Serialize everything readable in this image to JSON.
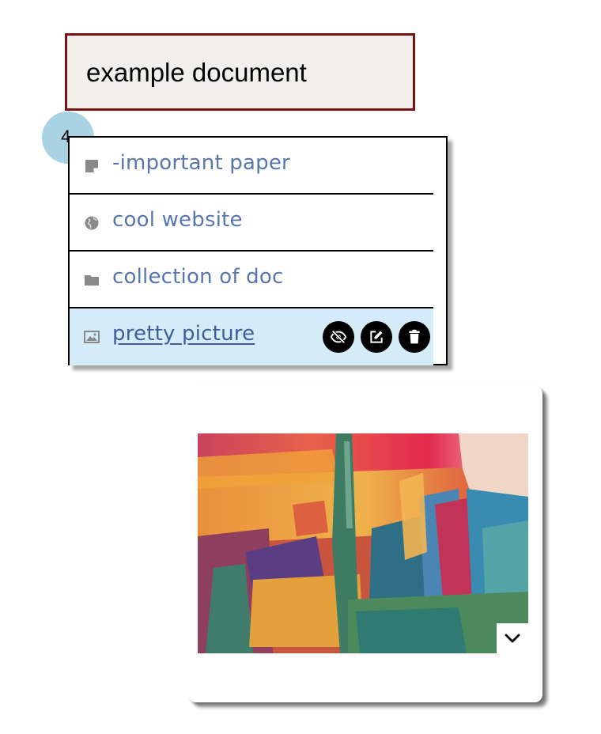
{
  "document": {
    "title": "example document",
    "item_count": "4"
  },
  "items": [
    {
      "label": "-important paper",
      "icon": "note-icon",
      "kind": "document"
    },
    {
      "label": "cool website",
      "icon": "globe-icon",
      "kind": "website"
    },
    {
      "label": "collection of doc",
      "icon": "folder-icon",
      "kind": "folder"
    },
    {
      "label": "pretty picture",
      "icon": "image-icon",
      "kind": "image",
      "selected": true
    }
  ],
  "selected_item_actions": [
    "hide-icon",
    "edit-icon",
    "delete-icon"
  ],
  "preview": {
    "description_icon": "chevron-down-icon"
  },
  "colors": {
    "title_border": "#7a1414",
    "title_background": "#f0efeb",
    "badge": "#a9d3e2",
    "link": "#5876ae",
    "selected_row": "#d3ecf7"
  }
}
